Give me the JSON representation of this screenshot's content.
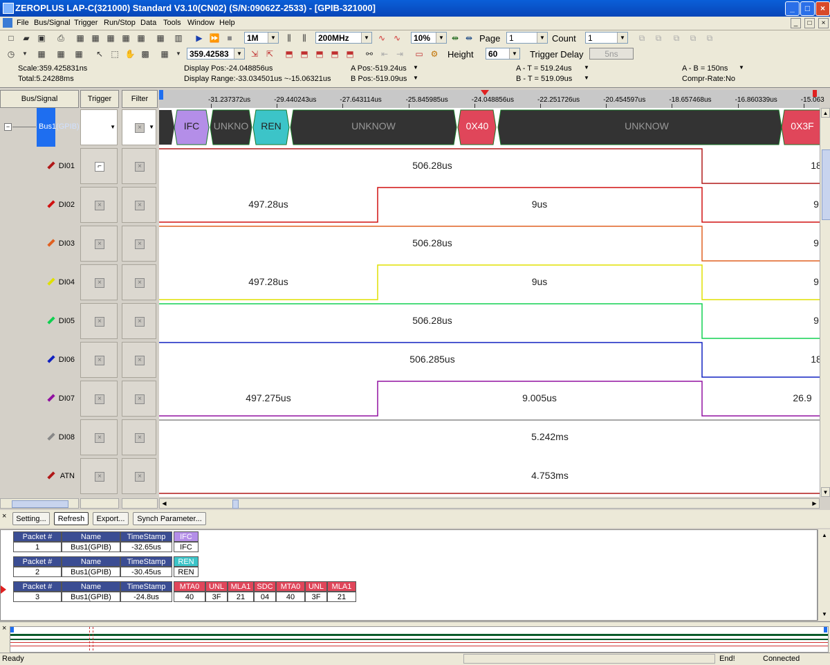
{
  "window": {
    "title": "ZEROPLUS LAP-C(321000) Standard V3.10(CN02) (S/N:09062Z-2533) - [GPIB-321000]"
  },
  "menu": [
    "File",
    "Bus/Signal",
    "Trigger",
    "Run/Stop",
    "Data",
    "Tools",
    "Window",
    "Help"
  ],
  "toolbar1": {
    "memory_depth": "1M",
    "sample_rate": "200MHz",
    "trigger_position": "10%",
    "page_label": "Page",
    "page_value": "1",
    "count_label": "Count",
    "count_value": "1"
  },
  "toolbar2": {
    "zoom_value": "359.42583",
    "height_label": "Height",
    "height_value": "60",
    "trigger_delay_label": "Trigger Delay",
    "trigger_delay_value": "5ns"
  },
  "info": {
    "scale": "Scale:359.425831ns",
    "total": "Total:5.24288ms",
    "display_pos": "Display Pos:-24.048856us",
    "display_range": "Display Range:-33.034501us ~-15.06321us",
    "a_pos": "A Pos:-519.24us",
    "b_pos": "B Pos:-519.09us",
    "a_t": "A - T = 519.24us",
    "b_t": "B - T = 519.09us",
    "a_b": "A - B = 150ns",
    "compr_rate": "Compr-Rate:No"
  },
  "columns": {
    "bus_signal": "Bus/Signal",
    "trigger": "Trigger",
    "filter": "Filter"
  },
  "bus": {
    "name": "Bus1",
    "type": "(GPIB)"
  },
  "signals": [
    {
      "name": "DI01",
      "color": "#b01818"
    },
    {
      "name": "DI02",
      "color": "#d01010"
    },
    {
      "name": "DI03",
      "color": "#e06020"
    },
    {
      "name": "DI04",
      "color": "#e0e000"
    },
    {
      "name": "DI05",
      "color": "#10d050"
    },
    {
      "name": "DI06",
      "color": "#1020c0"
    },
    {
      "name": "DI07",
      "color": "#9010a0"
    },
    {
      "name": "DI08",
      "color": "#888888"
    },
    {
      "name": "ATN",
      "color": "#b01818"
    }
  ],
  "ruler_ticks": [
    "-31.237372us",
    "-29.440243us",
    "-27.643114us",
    "-25.845985us",
    "-24.048856us",
    "-22.251726us",
    "-20.454597us",
    "-18.657468us",
    "-16.860339us",
    "-15.063"
  ],
  "bus_segments": [
    "IFC",
    "UNKNO",
    "REN",
    "UNKNOW",
    "0X40",
    "UNKNOW",
    "0X3F"
  ],
  "wave_labels": {
    "di01": [
      "506.28us",
      "18"
    ],
    "di02": [
      "497.28us",
      "9us",
      "9"
    ],
    "di03": [
      "506.28us",
      "9"
    ],
    "di04": [
      "497.28us",
      "9us",
      "9"
    ],
    "di05": [
      "506.28us",
      "9"
    ],
    "di06": [
      "506.285us",
      "18"
    ],
    "di07": [
      "497.275us",
      "9.005us",
      "26.9"
    ],
    "di08": [
      "5.242ms"
    ],
    "atn": [
      "4.753ms"
    ]
  },
  "bottom_buttons": [
    "Setting...",
    "Refresh",
    "Export...",
    "Synch Parameter..."
  ],
  "packet_headers": [
    "Packet #",
    "Name",
    "TimeStamp"
  ],
  "packets": [
    {
      "num": "1",
      "name": "Bus1(GPIB)",
      "ts": "-32.65us",
      "fields": [
        {
          "h": "IFC",
          "v": "IFC",
          "c": "#b48ee8"
        }
      ]
    },
    {
      "num": "2",
      "name": "Bus1(GPIB)",
      "ts": "-30.45us",
      "fields": [
        {
          "h": "REN",
          "v": "REN",
          "c": "#3cc4c8"
        }
      ]
    },
    {
      "num": "3",
      "name": "Bus1(GPIB)",
      "ts": "-24.8us",
      "fields": [
        {
          "h": "MTA0",
          "v": "40",
          "c": "#e0465a"
        },
        {
          "h": "UNL",
          "v": "3F",
          "c": "#e0465a"
        },
        {
          "h": "MLA1",
          "v": "21",
          "c": "#e0465a"
        },
        {
          "h": "SDC",
          "v": "04",
          "c": "#e0465a"
        },
        {
          "h": "MTA0",
          "v": "40",
          "c": "#e0465a"
        },
        {
          "h": "UNL",
          "v": "3F",
          "c": "#e0465a"
        },
        {
          "h": "MLA1",
          "v": "21",
          "c": "#e0465a"
        }
      ]
    }
  ],
  "status": {
    "left": "Ready",
    "end": "End!",
    "conn": "Connected"
  }
}
